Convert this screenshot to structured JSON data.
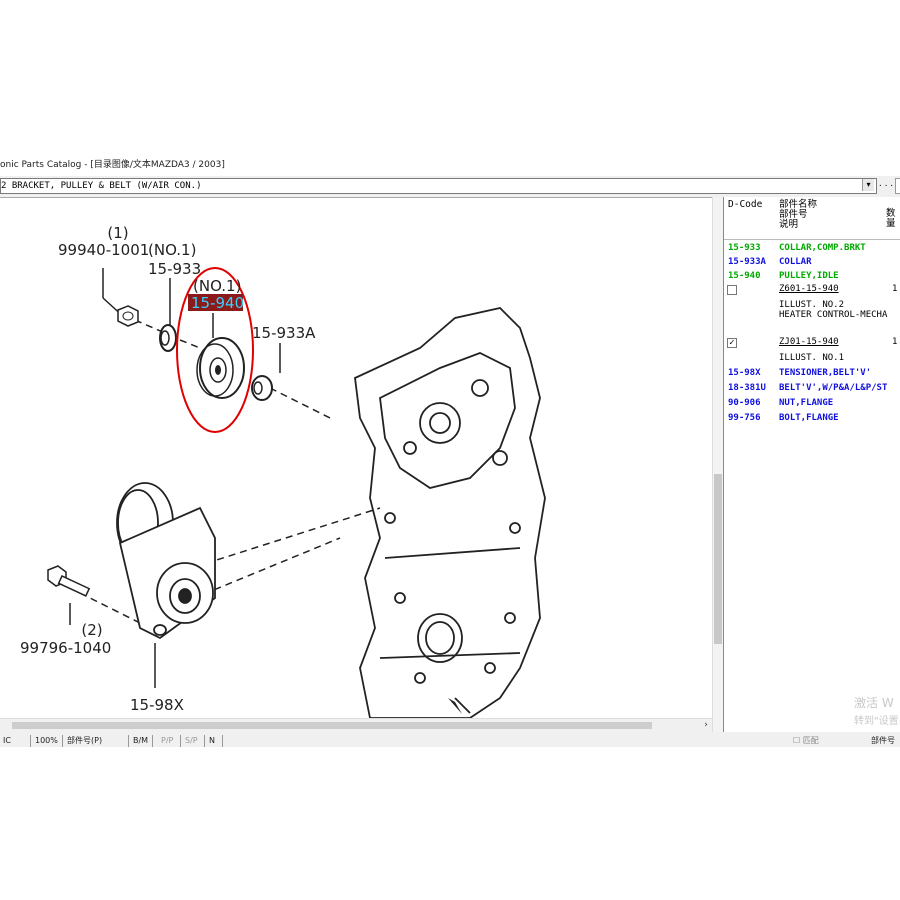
{
  "window": {
    "title": "onic Parts Catalog - [目录图像/文本MAZDA3 / 2003]",
    "combo_value": "2 BRACKET, PULLEY & BELT (W/AIR CON.)",
    "combo_arrow": "▾",
    "ellipsis_button": ". . ."
  },
  "diagram": {
    "labels": {
      "part_99940": "99940-1001",
      "qty_1a": "(1)",
      "no1_a": "(NO.1)",
      "part_15933": "15-933",
      "no1_b": "(NO.1)",
      "part_15940": "15-940",
      "part_15933A": "15-933A",
      "qty_2": "(2)",
      "part_99796": "99796-1040",
      "part_1598X": "15-98X"
    },
    "highlight_color": "#8b1a1a",
    "highlight_text_color": "#3ad0ff",
    "circle_color": "#e00000"
  },
  "table": {
    "headers": {
      "dcode": "D-Code",
      "name_line1": "部件名称",
      "name_line2": "部件号",
      "name_line3": "说明",
      "qty": "数量"
    },
    "rows": [
      {
        "code": "15-933",
        "name": "COLLAR,COMP.BRKT",
        "color": "green"
      },
      {
        "code": "15-933A",
        "name": "COLLAR",
        "color": "blue"
      },
      {
        "code": "15-940",
        "name": "PULLEY,IDLE",
        "color": "green"
      }
    ],
    "sub1": {
      "part": "Z601-15-940",
      "qty": "1",
      "note1": "ILLUST. NO.2",
      "note2": "HEATER CONTROL-MECHA",
      "checked": false
    },
    "sub2": {
      "part": "ZJ01-15-940",
      "qty": "1",
      "note1": "ILLUST. NO.1",
      "checked": true,
      "check_mark": "✓"
    },
    "rows2": [
      {
        "code": "15-98X",
        "name": "TENSIONER,BELT'V'",
        "color": "blue"
      },
      {
        "code": "18-381U",
        "name": "BELT'V',W/P&A/L&P/ST",
        "color": "blue"
      },
      {
        "code": "90-906",
        "name": "NUT,FLANGE",
        "color": "blue"
      },
      {
        "code": "99-756",
        "name": "BOLT,FLANGE",
        "color": "blue"
      }
    ]
  },
  "watermark": {
    "line1": "激活 W",
    "line2": "转到\"设置"
  },
  "statusbar": {
    "cells": [
      "IC",
      "100%",
      "部件号(P)",
      "B/M",
      "P/P",
      "S/P",
      "N"
    ],
    "right1": "匹配",
    "right2": "部件号"
  }
}
